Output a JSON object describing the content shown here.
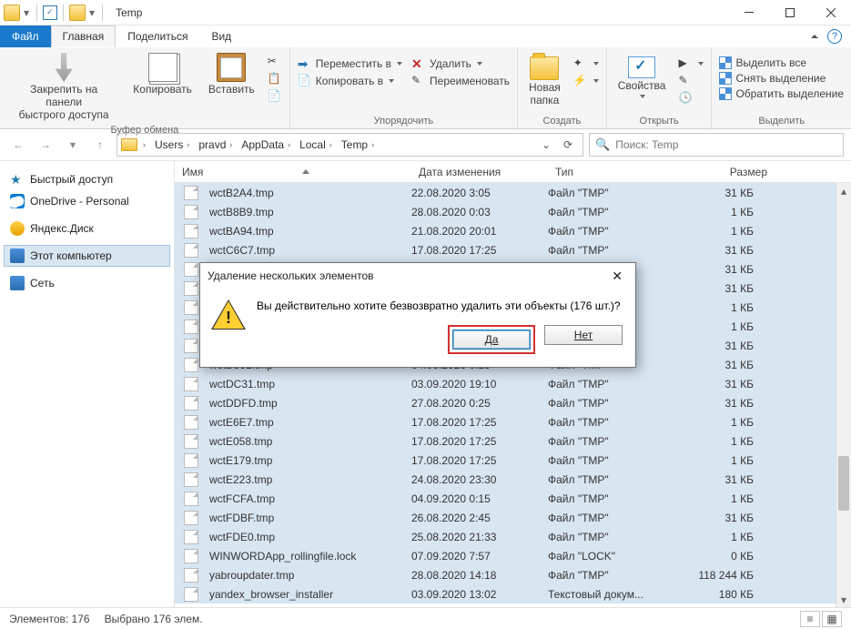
{
  "titlebar": {
    "title": "Temp"
  },
  "tabs": {
    "file": "Файл",
    "home": "Главная",
    "share": "Поделиться",
    "view": "Вид"
  },
  "ribbon": {
    "clipboard": {
      "pin": "Закрепить на панели\nбыстрого доступа",
      "copy": "Копировать",
      "paste": "Вставить",
      "label": "Буфер обмена"
    },
    "organize": {
      "move": "Переместить в",
      "copyto": "Копировать в",
      "delete": "Удалить",
      "rename": "Переименовать",
      "label": "Упорядочить"
    },
    "new": {
      "newfolder": "Новая\nпапка",
      "label": "Создать"
    },
    "open": {
      "props": "Свойства",
      "label": "Открыть"
    },
    "select": {
      "all": "Выделить все",
      "none": "Снять выделение",
      "invert": "Обратить выделение",
      "label": "Выделить"
    }
  },
  "breadcrumbs": [
    "Users",
    "pravd",
    "AppData",
    "Local",
    "Temp"
  ],
  "search": {
    "placeholder": "Поиск: Temp"
  },
  "sidebar": {
    "items": [
      {
        "label": "Быстрый доступ",
        "ico": "star"
      },
      {
        "label": "OneDrive - Personal",
        "ico": "cloud"
      },
      {
        "label": "Яндекс.Диск",
        "ico": "disk"
      },
      {
        "label": "Этот компьютер",
        "ico": "pc",
        "sel": true
      },
      {
        "label": "Сеть",
        "ico": "net"
      }
    ]
  },
  "columns": {
    "name": "Имя",
    "date": "Дата изменения",
    "type": "Тип",
    "size": "Размер"
  },
  "files": [
    {
      "name": "wctB2A4.tmp",
      "date": "22.08.2020 3:05",
      "type": "Файл \"TMP\"",
      "size": "31 КБ"
    },
    {
      "name": "wctB8B9.tmp",
      "date": "28.08.2020 0:03",
      "type": "Файл \"TMP\"",
      "size": "1 КБ"
    },
    {
      "name": "wctBA94.tmp",
      "date": "21.08.2020 20:01",
      "type": "Файл \"TMP\"",
      "size": "1 КБ"
    },
    {
      "name": "wctC6C7.tmp",
      "date": "17.08.2020 17:25",
      "type": "Файл \"TMP\"",
      "size": "31 КБ"
    },
    {
      "name": "wct",
      "date": "",
      "type": "",
      "size": "31 КБ"
    },
    {
      "name": "wct",
      "date": "",
      "type": "",
      "size": "31 КБ"
    },
    {
      "name": "wct",
      "date": "",
      "type": "",
      "size": "1 КБ"
    },
    {
      "name": "wct",
      "date": "",
      "type": "",
      "size": "1 КБ"
    },
    {
      "name": "wct",
      "date": "",
      "type": "",
      "size": "31 КБ"
    },
    {
      "name": "wctD331.tmp",
      "date": "04.09.2020 0:15",
      "type": "Файл \"TMP\"",
      "size": "31 КБ"
    },
    {
      "name": "wctDC31.tmp",
      "date": "03.09.2020 19:10",
      "type": "Файл \"TMP\"",
      "size": "31 КБ"
    },
    {
      "name": "wctDDFD.tmp",
      "date": "27.08.2020 0:25",
      "type": "Файл \"TMP\"",
      "size": "31 КБ"
    },
    {
      "name": "wctE6E7.tmp",
      "date": "17.08.2020 17:25",
      "type": "Файл \"TMP\"",
      "size": "1 КБ"
    },
    {
      "name": "wctE058.tmp",
      "date": "17.08.2020 17:25",
      "type": "Файл \"TMP\"",
      "size": "1 КБ"
    },
    {
      "name": "wctE179.tmp",
      "date": "17.08.2020 17:25",
      "type": "Файл \"TMP\"",
      "size": "1 КБ"
    },
    {
      "name": "wctE223.tmp",
      "date": "24.08.2020 23:30",
      "type": "Файл \"TMP\"",
      "size": "31 КБ"
    },
    {
      "name": "wctFCFA.tmp",
      "date": "04.09.2020 0:15",
      "type": "Файл \"TMP\"",
      "size": "1 КБ"
    },
    {
      "name": "wctFDBF.tmp",
      "date": "26.08.2020 2:45",
      "type": "Файл \"TMP\"",
      "size": "31 КБ"
    },
    {
      "name": "wctFDE0.tmp",
      "date": "25.08.2020 21:33",
      "type": "Файл \"TMP\"",
      "size": "1 КБ"
    },
    {
      "name": "WINWORDApp_rollingfile.lock",
      "date": "07.09.2020 7:57",
      "type": "Файл \"LOCK\"",
      "size": "0 КБ"
    },
    {
      "name": "yabroupdater.tmp",
      "date": "28.08.2020 14:18",
      "type": "Файл \"TMP\"",
      "size": "118 244 КБ"
    },
    {
      "name": "yandex_browser_installer",
      "date": "03.09.2020 13:02",
      "type": "Текстовый докум...",
      "size": "180 КБ"
    }
  ],
  "status": {
    "count": "Элементов: 176",
    "selected": "Выбрано 176 элем."
  },
  "dialog": {
    "title": "Удаление нескольких элементов",
    "message": "Вы действительно хотите безвозвратно удалить эти объекты (176 шт.)?",
    "yes": "Да",
    "no": "Нет"
  }
}
